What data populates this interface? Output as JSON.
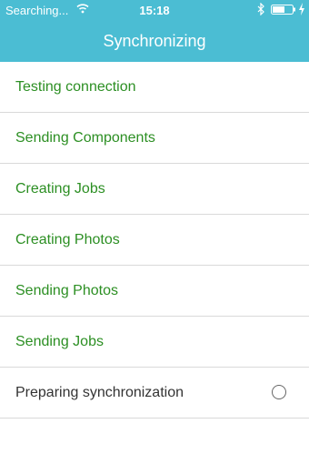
{
  "status_bar": {
    "carrier": "Searching...",
    "time": "15:18",
    "wifi_icon": "wifi-icon",
    "bluetooth_icon": "bluetooth-icon",
    "battery_icon": "battery-icon",
    "charging_icon": "charging-icon"
  },
  "header": {
    "title": "Synchronizing"
  },
  "steps": [
    {
      "label": "Testing connection",
      "state": "done"
    },
    {
      "label": "Sending Components",
      "state": "done"
    },
    {
      "label": "Creating Jobs",
      "state": "done"
    },
    {
      "label": "Creating Photos",
      "state": "done"
    },
    {
      "label": "Sending Photos",
      "state": "done"
    },
    {
      "label": "Sending Jobs",
      "state": "done"
    },
    {
      "label": "Preparing synchronization",
      "state": "pending",
      "indicator_icon": "radio-circle-icon"
    }
  ],
  "colors": {
    "header_bg": "#4bbdd3",
    "done_text": "#2c8f23",
    "pending_text": "#333333",
    "divider": "#d9d9d9"
  }
}
